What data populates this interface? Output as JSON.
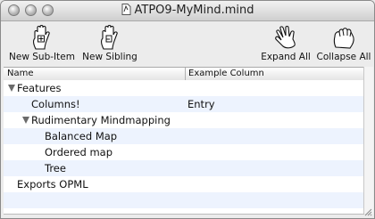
{
  "window": {
    "title": "ATPO9-MyMind.mind"
  },
  "toolbar": {
    "new_sub_item": "New Sub-Item",
    "new_sibling": "New Sibling",
    "expand_all": "Expand All",
    "collapse_all": "Collapse All"
  },
  "outline": {
    "columns": [
      "Name",
      "Example Column"
    ],
    "rows": [
      {
        "name": "Features",
        "value": "",
        "expanded": true
      },
      {
        "name": "Columns!",
        "value": "Entry"
      },
      {
        "name": "Rudimentary Mindmapping",
        "value": "",
        "expanded": true
      },
      {
        "name": "Balanced Map",
        "value": ""
      },
      {
        "name": "Ordered map",
        "value": ""
      },
      {
        "name": "Tree",
        "value": ""
      },
      {
        "name": "Exports OPML",
        "value": ""
      }
    ]
  },
  "icons": {
    "traffic_lights": [
      "close-button",
      "minimize-button",
      "zoom-button"
    ],
    "toolbar": [
      "hand-plus-icon",
      "hand-sibling-icon",
      "open-hand-icon",
      "grab-hand-icon"
    ]
  }
}
